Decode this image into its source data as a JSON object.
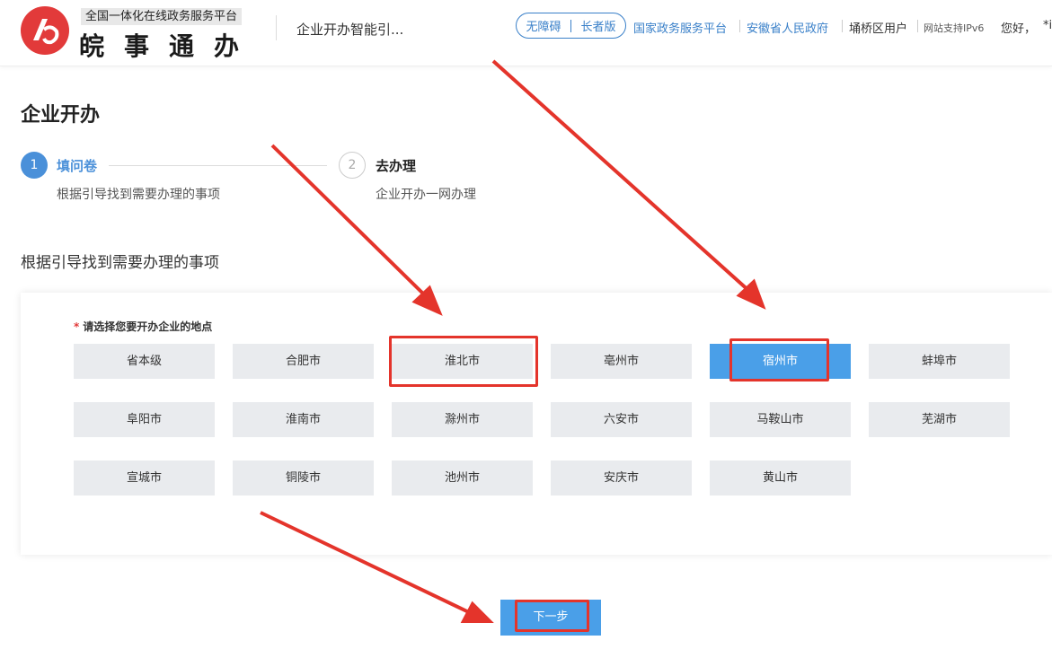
{
  "header": {
    "logo_tag": "全国一体化在线政务服务平台",
    "logo_name": "皖事通办",
    "title": "企业开办智能引...",
    "pill": {
      "accessible": "无障碍",
      "elder": "长者版"
    },
    "links": [
      "国家政务服务平台",
      "安徽省人民政府",
      "埇桥区用户",
      "网站支持IPv6",
      "您好，",
      "*i"
    ],
    "colors": {
      "brand_red": "#e23a3a",
      "link_blue": "#3a80c9"
    }
  },
  "page": {
    "title": "企业开办",
    "steps": [
      {
        "num": "1",
        "label": "填问卷",
        "desc": "根据引导找到需要办理的事项"
      },
      {
        "num": "2",
        "label": "去办理",
        "desc": "企业开办一网办理"
      }
    ],
    "section_title": "根据引导找到需要办理的事项"
  },
  "form": {
    "required_mark": "*",
    "location_label": "请选择您要开办企业的地点",
    "cities": [
      "省本级",
      "合肥市",
      "淮北市",
      "亳州市",
      "宿州市",
      "蚌埠市",
      "阜阳市",
      "淮南市",
      "滁州市",
      "六安市",
      "马鞍山市",
      "芜湖市",
      "宣城市",
      "铜陵市",
      "池州市",
      "安庆市",
      "黄山市"
    ],
    "selected_city": "宿州市",
    "accent_color": "#4a9fe8"
  },
  "actions": {
    "next": "下一步"
  }
}
